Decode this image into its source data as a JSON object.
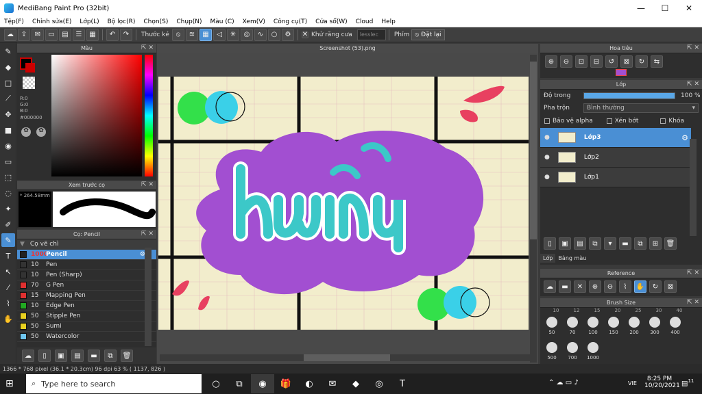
{
  "window": {
    "title": "MediBang Paint Pro (32bit)",
    "minimize": "—",
    "maximize": "☐",
    "close": "✕"
  },
  "menu": [
    "Tệp(F)",
    "Chỉnh sửa(E)",
    "Lớp(L)",
    "Bộ lọc(R)",
    "Chọn(S)",
    "Chụp(N)",
    "Màu (C)",
    "Xem(V)",
    "Công cụ(T)",
    "Cửa sổ(W)",
    "Cloud",
    "Help"
  ],
  "toolbar": {
    "ruler_label": "Thước kẻ",
    "antialias_label": "Khử răng cưa",
    "snap_input": "lesslec",
    "key_label": "Phím",
    "reset_label": "Đặt lại"
  },
  "color_panel": {
    "title": "Màu",
    "r": "R:0",
    "g": "G:0",
    "b": "B:0",
    "hex": "#000000"
  },
  "preview_panel": {
    "title": "Xem trước cọ",
    "size": "* 264.58mm"
  },
  "brush_panel": {
    "title": "Cọ: Pencil",
    "group": "Cọ vẽ chì",
    "brushes": [
      {
        "size": "1000",
        "name": "Pencil",
        "color": "#222222",
        "selected": true
      },
      {
        "size": "10",
        "name": "Pen",
        "color": "#333333"
      },
      {
        "size": "10",
        "name": "Pen (Sharp)",
        "color": "#333333"
      },
      {
        "size": "70",
        "name": "G Pen",
        "color": "#e03030"
      },
      {
        "size": "15",
        "name": "Mapping Pen",
        "color": "#e03030"
      },
      {
        "size": "10",
        "name": "Edge Pen",
        "color": "#22aa22"
      },
      {
        "size": "50",
        "name": "Stipple Pen",
        "color": "#e8d020"
      },
      {
        "size": "50",
        "name": "Sumi",
        "color": "#e8d020"
      },
      {
        "size": "50",
        "name": "Watercolor",
        "color": "#6ec6f0"
      }
    ]
  },
  "canvas": {
    "title": "Screenshot (53).png"
  },
  "navigator": {
    "title": "Hoa tiêu"
  },
  "layers": {
    "title": "Lớp",
    "opacity_label": "Độ trong",
    "opacity_value": "100 %",
    "opacity_fraction": 1.0,
    "blend_label": "Pha trộn",
    "blend_value": "Bình thường",
    "protect_alpha": "Bảo vệ alpha",
    "clipping": "Xén bớt",
    "lock": "Khóa",
    "items": [
      {
        "name": "Lớp3",
        "selected": true
      },
      {
        "name": "Lớp2"
      },
      {
        "name": "Lớp1"
      }
    ],
    "tab_layer": "Lớp",
    "tab_palette": "Bảng màu"
  },
  "reference": {
    "title": "Reference"
  },
  "brush_size": {
    "title": "Brush Size",
    "top_row": [
      "10",
      "12",
      "15",
      "20",
      "25",
      "30",
      "40"
    ],
    "sizes": [
      "50",
      "70",
      "100",
      "150",
      "200",
      "300",
      "400",
      "500",
      "700",
      "1000"
    ]
  },
  "status": {
    "text": "1366 * 768 pixel   (36.1 * 20.3cm)   96 dpi   63 %   ( 1137, 826 )"
  },
  "taskbar": {
    "search_placeholder": "Type here to search",
    "time": "8:25 PM",
    "date": "10/20/2021",
    "lang": "VIE",
    "notif_count": "11"
  }
}
